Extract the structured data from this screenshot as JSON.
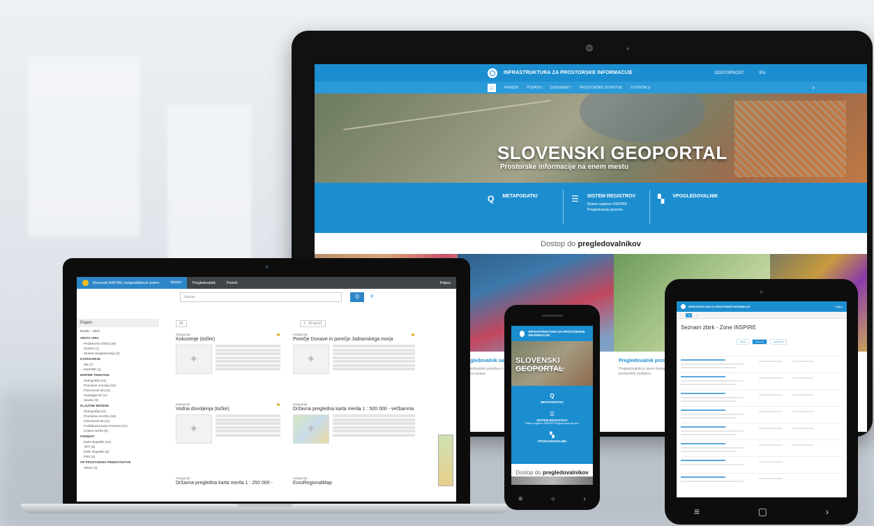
{
  "monitor": {
    "header": {
      "title": "INFRASTRUKTURA ZA PROSTORSKE INFORMACIJE",
      "accessibility": "DOSTOPNOST",
      "language": "EN"
    },
    "nav": {
      "items": [
        "PRAZEN",
        "PODATKI",
        "DOKUMENTI",
        "PROSTORSKE STORITVE",
        "O PORTALU"
      ]
    },
    "hero": {
      "title": "SLOVENSKI GEOPORTAL",
      "subtitle": "Prostorske informacije na enem mestu"
    },
    "band": {
      "items": [
        {
          "icon": "search-icon",
          "label": "METAPODATKI",
          "sub": ""
        },
        {
          "icon": "list-icon",
          "label": "SISTEM REGISTROV",
          "sub": "Sistem registrov INSPIRE",
          "sub2": "Pregledovanje govorov"
        },
        {
          "icon": "map-icon",
          "label": "VPOGLEDOVALNIK",
          "sub": ""
        }
      ]
    },
    "access_heading": {
      "pre": "Dostop do ",
      "bold": "pregledovalnikov"
    },
    "captions": [
      {
        "title": "Pregledovalnik naravnih območij",
        "text": "Pregledovalnik podatkov o zaščitenih območjih in sistemu varstva narave."
      },
      {
        "title": "Pregledovalnik prost...",
        "text": "Pregledovalnik je javno dostopna spletna storitev za ogled prostorskih podatkov."
      }
    ]
  },
  "laptop": {
    "topbar": {
      "brand": "Slovenski INSPIRE metapodatkovni sistem",
      "tab_search": "Iskanje",
      "tab_help": "Pomoč",
      "tab_map": "Pregledovalnik",
      "login": "Prijava"
    },
    "search": {
      "placeholder": "Iskanje ...",
      "button": "Q"
    },
    "pager": "1 - 20 od 21",
    "dropdown": "20",
    "sidebar": {
      "title": "Pojem",
      "controls": [
        "Razširi",
        "Skrči"
      ],
      "sections": [
        {
          "title": "VRSTA VIRA",
          "items": [
            "Podatkovna zbirka (20)",
            "Storitev (1)",
            "Storitev pregledovanja (3)"
          ]
        },
        {
          "title": "KATEGORIJE",
          "items": [
            "MK (7)",
            "INSPIRE (4)"
          ]
        },
        {
          "title": "INSPIRE TEMATIKE",
          "items": [
            "Hidrografija (21)",
            "Prometna omrežja (15)",
            "Pokrovnost tal (14)",
            "Geologija tal (11)",
            "Stavbe (9)"
          ]
        },
        {
          "title": "KLJUČNE BESEDE",
          "items": [
            "Hidrografija (21)",
            "Prometna omrežja (15)",
            "Pokrovnost tal (11)",
            "Podatkovna baza Potresov (11)",
            "Cestne mreže (5)"
          ]
        },
        {
          "title": "FORMATI",
          "items": [
            "ESRI shapefile (12)",
            "TIFF (8)",
            "ESRI shapefile (5)",
            "PNG (3)"
          ]
        },
        {
          "title": "OP PROSTORSKI PREDSTAVITVE",
          "items": [
            "Vektor (3)"
          ]
        }
      ]
    },
    "cards": [
      {
        "category": "Kategorije:",
        "title": "Kokosenje (točke)"
      },
      {
        "category": "Kategorije:",
        "title": "Porečje Donave in porečje Jadranskega morja"
      },
      {
        "category": "Kategorije:",
        "title": "Vodna dovoljenja (točke)"
      },
      {
        "category": "Kategorije:",
        "title": "Državna pregledna karta merila 1 : 500 000 - večbarvna"
      },
      {
        "category": "Kategorije:",
        "title": "Državna pregledna karta merila 1 : 250 000 -"
      },
      {
        "category": "Kategorije:",
        "title": "EuroRegionalMap"
      }
    ]
  },
  "phone": {
    "header": "INFRASTRUKTURA ZA PROSTORSKE INFORMACIJE",
    "hero": {
      "title": "SLOVENSKI GEOPORTAL",
      "subtitle": "Prostorske informacije na enem mestu"
    },
    "band": {
      "items": [
        "METAPODATKI",
        "SISTEM REGISTROV",
        "VPOGLEDOVALNIK"
      ],
      "sub": "Sistem registrov INSPIRE Pregledovanje govorov"
    },
    "access_heading": {
      "pre": "Dostop do ",
      "bold": "pregledovalnikov"
    }
  },
  "tablet": {
    "header": "INFRASTRUKTURA ZA PROSTORSKE INFORMACIJE",
    "header_right": "Prijava",
    "title": "Seznam zbirk - Zone INSPIRE",
    "tabs": [
      "Zbirke",
      "Elementi",
      "Zgodovina"
    ]
  },
  "colors": {
    "brand_blue": "#1c8ed0",
    "dark_frame": "#0d0d0d",
    "accent_gold": "#d9a300"
  }
}
